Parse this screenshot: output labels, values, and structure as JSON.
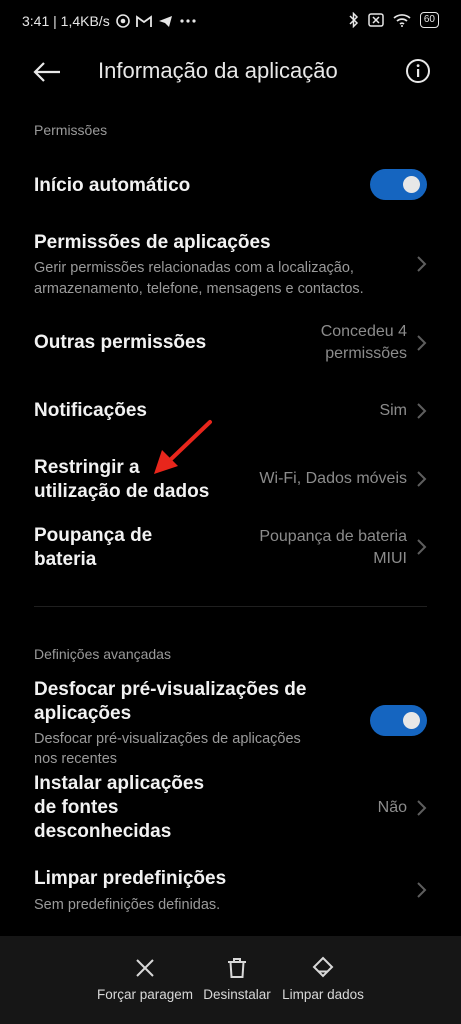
{
  "status_bar": {
    "time_speed": "3:41 | 1,4KB/s",
    "battery": "60"
  },
  "header": {
    "title": "Informação da aplicação"
  },
  "sections": {
    "permissions_label": "Permissões",
    "advanced_label": "Definições avançadas"
  },
  "rows": {
    "auto_start": {
      "title": "Início automático",
      "toggle_on": true
    },
    "app_permissions": {
      "title": "Permissões de aplicações",
      "subtitle_1": "Gerir permissões relacionadas com a localização,",
      "subtitle_2": "armazenamento, telefone, mensagens e contactos."
    },
    "other_permissions": {
      "title": "Outras permissões",
      "value_1": "Concedeu 4",
      "value_2": "permissões"
    },
    "notifications": {
      "title": "Notificações",
      "value": "Sim"
    },
    "restrict_data": {
      "title_1": "Restringir a",
      "title_2": "utilização de dados",
      "value": "Wi-Fi, Dados móveis"
    },
    "battery_saver": {
      "title_1": "Poupança de",
      "title_2": "bateria",
      "value_1": "Poupança de bateria",
      "value_2": "MIUI"
    },
    "blur_previews": {
      "title_1": "Desfocar pré-visualizações de",
      "title_2": "aplicações",
      "subtitle_1": "Desfocar pré-visualizações de aplicações",
      "subtitle_2": "nos recentes",
      "toggle_on": true
    },
    "unknown_sources": {
      "title_1": "Instalar aplicações",
      "title_2": "de fontes",
      "title_3": "desconhecidas",
      "value": "Não"
    },
    "clear_defaults": {
      "title": "Limpar predefinições",
      "subtitle": "Sem predefinições definidas."
    }
  },
  "bottom_actions": {
    "force_stop": "Forçar paragem",
    "uninstall": "Desinstalar",
    "clear_data": "Limpar dados"
  },
  "colors": {
    "background": "#000000",
    "toggle_on": "#1565c0",
    "annotation_arrow": "#e8261c"
  },
  "icons": [
    "back-arrow-icon",
    "info-icon",
    "chevron-right-icon",
    "close-x-icon",
    "trash-icon",
    "eraser-icon",
    "bluetooth-icon",
    "wifi-icon"
  ]
}
